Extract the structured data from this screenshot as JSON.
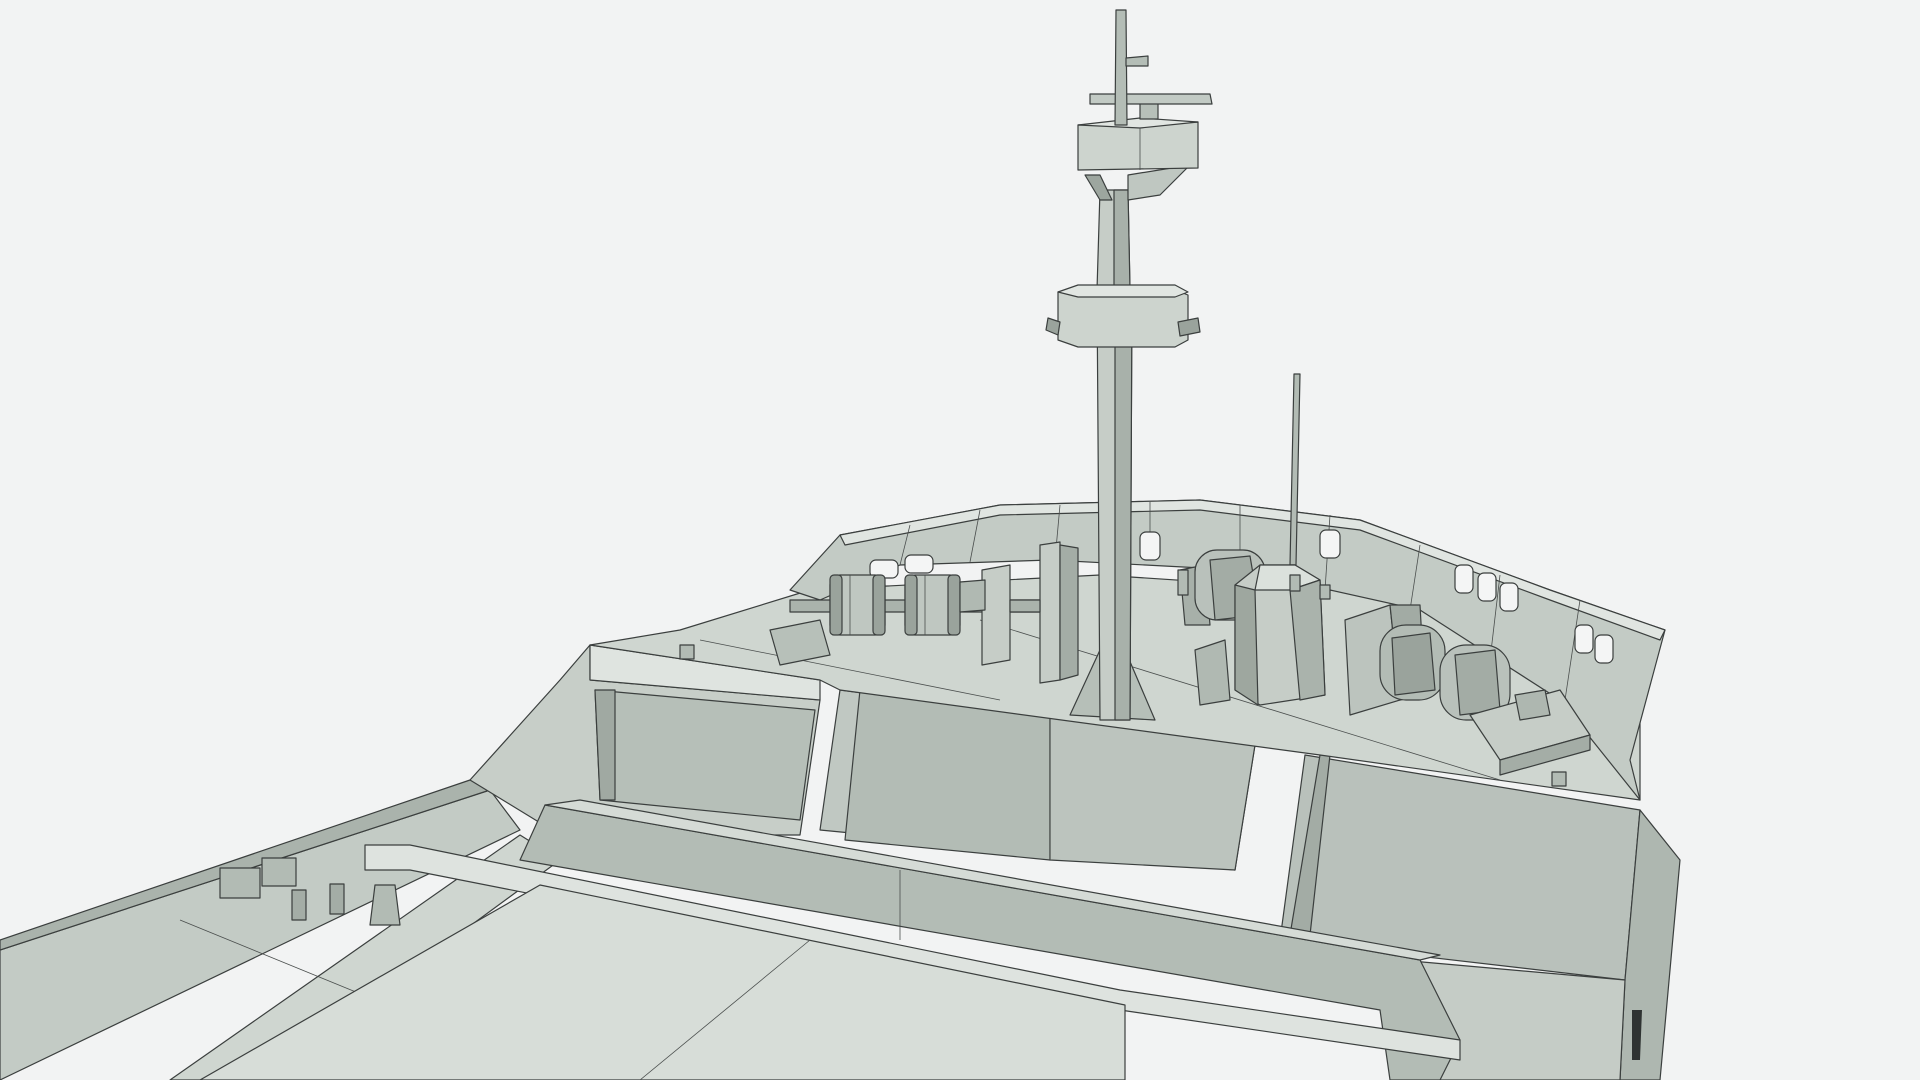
{
  "scene": {
    "subject": "",
    "colors": {
      "background": "#f2f3f3",
      "hull_light": "#d3d9d4",
      "hull_mid": "#b7c0b9",
      "hull_dark": "#8e9891",
      "deck": "#c9d0ca",
      "wire": "#3b3f3e",
      "shadow": "#6f7872"
    }
  }
}
